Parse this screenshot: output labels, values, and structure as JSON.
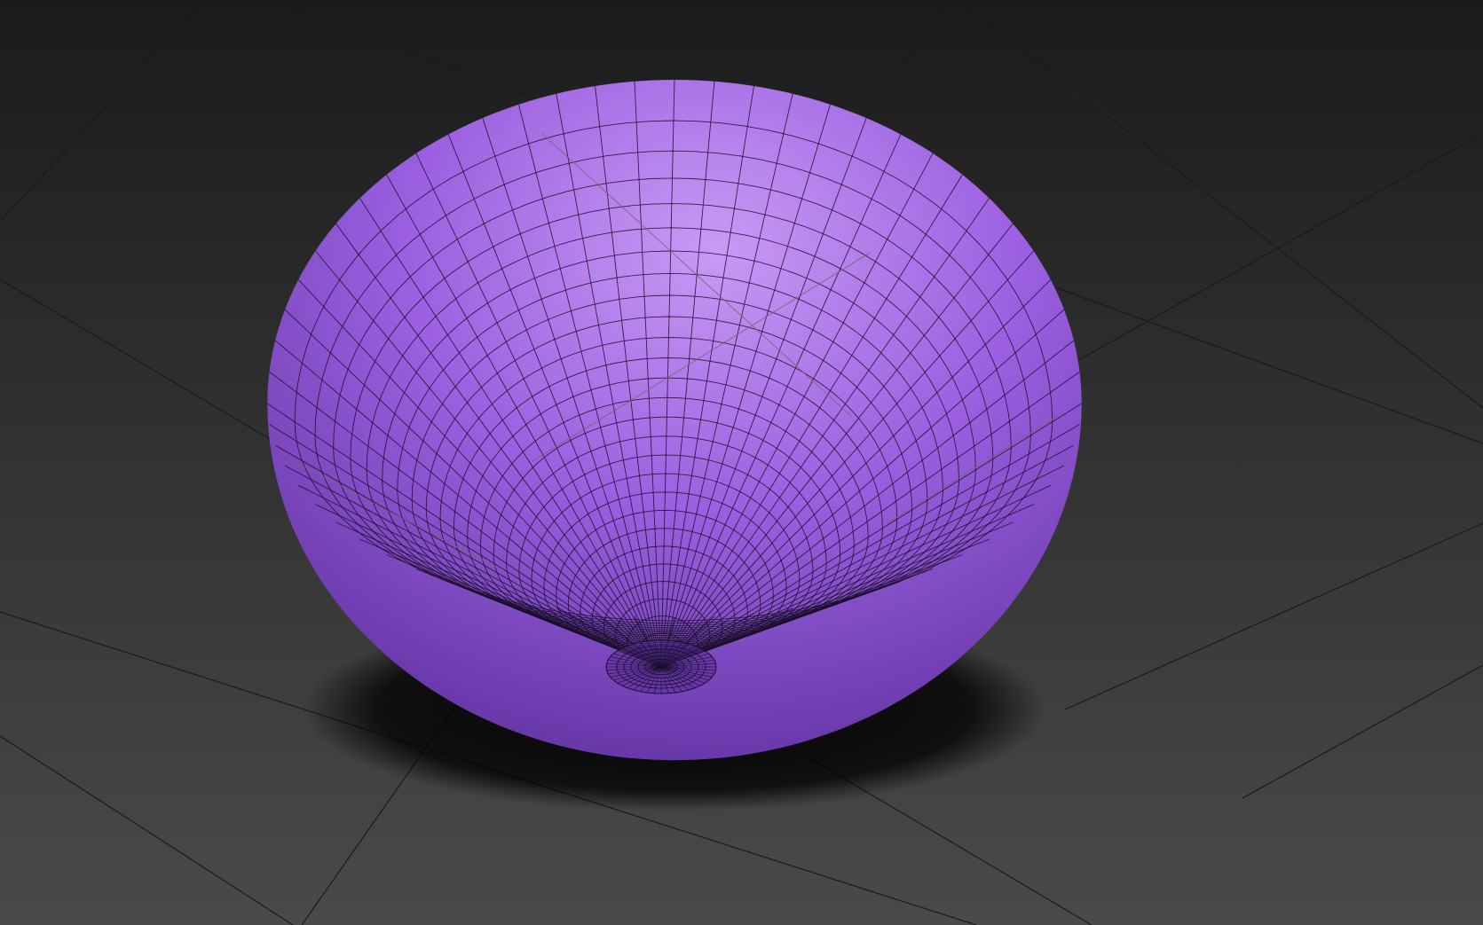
{
  "viewport": {
    "mode": "perspective",
    "background_top": "#1b1b1b",
    "background_bottom": "#4a4a4a",
    "grid_line_color": "#1a1a1a",
    "grid_line_light": "#6a6a6a",
    "shadow_color": "#000000"
  },
  "object": {
    "shape": "bowl",
    "base_color": "#9b5fe0",
    "highlight_color": "#c99af5",
    "shade_color": "#5a2e9a",
    "wire_color": "#1a0f2a",
    "latitude_rings": 28,
    "longitude_segments": 64
  }
}
